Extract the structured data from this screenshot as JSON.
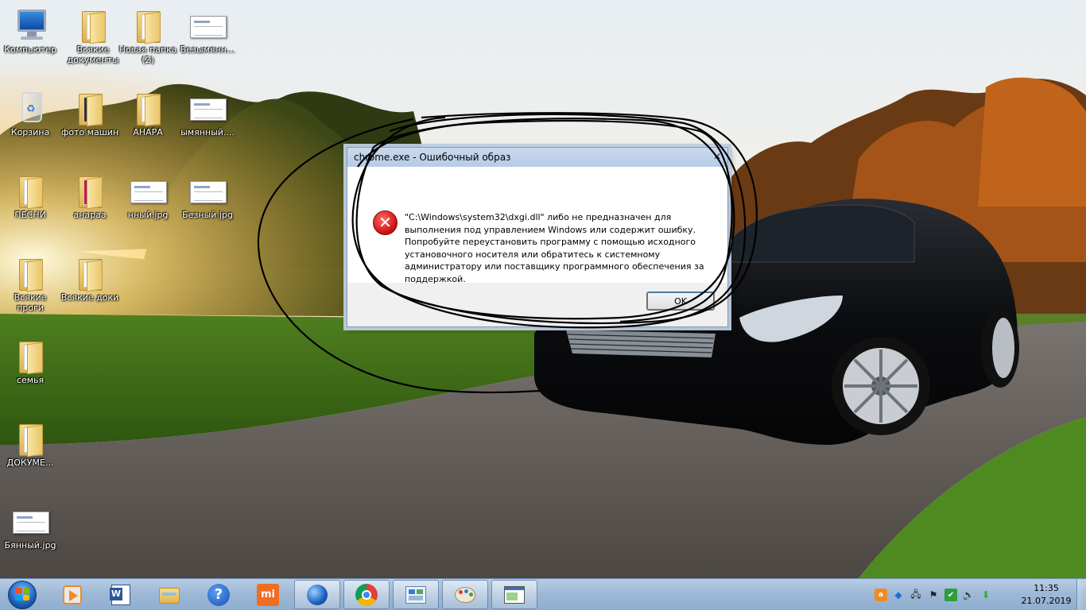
{
  "desktop": {
    "icons": [
      {
        "label": "Компьютер",
        "type": "computer"
      },
      {
        "label": "Всякие документы",
        "type": "folder"
      },
      {
        "label": "Новая папка (2)",
        "type": "folder"
      },
      {
        "label": "Безымянн...",
        "type": "image"
      },
      {
        "label": "Корзина",
        "type": "recycle-bin"
      },
      {
        "label": "фото машин",
        "type": "folder"
      },
      {
        "label": "АНАРА",
        "type": "folder"
      },
      {
        "label": "ымянный....",
        "type": "image"
      },
      {
        "label": "ПЕСНИ",
        "type": "folder"
      },
      {
        "label": "анараа",
        "type": "folder"
      },
      {
        "label": "нный.jpg",
        "type": "image"
      },
      {
        "label": "Безный.jpg",
        "type": "image"
      },
      {
        "label": "Всякие проги",
        "type": "folder"
      },
      {
        "label": "Всякие доки",
        "type": "folder"
      },
      {
        "label": "семья",
        "type": "folder"
      },
      {
        "label": "ДОКУМЕ...",
        "type": "folder"
      },
      {
        "label": "Бянный.jpg",
        "type": "image"
      }
    ]
  },
  "dialog": {
    "title": "chrome.exe - Ошибочный образ",
    "close_symbol": "✕",
    "icon": "error-icon",
    "error_symbol": "✕",
    "message": "\"C:\\Windows\\system32\\dxgi.dll\" либо не предназначен для\nвыполнения под управлением Windows или содержит ошибку.\nПопробуйте переустановить программу с помощью исходного\nустановочного носителя или обратитесь к системному\nадминистратору или поставщику программного обеспечения за\nподдержкой.",
    "ok_label": "OK"
  },
  "taskbar": {
    "buttons": [
      {
        "name": "media-player-icon"
      },
      {
        "name": "word-icon"
      },
      {
        "name": "explorer-icon"
      },
      {
        "name": "help-icon"
      },
      {
        "name": "mi-icon"
      },
      {
        "name": "browser-globe-icon"
      },
      {
        "name": "chrome-icon"
      },
      {
        "name": "control-panel-icon"
      },
      {
        "name": "paint-icon"
      },
      {
        "name": "window-app-icon"
      }
    ],
    "clock": {
      "time": "11:35",
      "date": "21.07.2019"
    }
  },
  "colors": {
    "taskbar": "#9fb9d6",
    "dialog_titlebar": "#b7cbe6",
    "error_red": "#c80e0e"
  }
}
